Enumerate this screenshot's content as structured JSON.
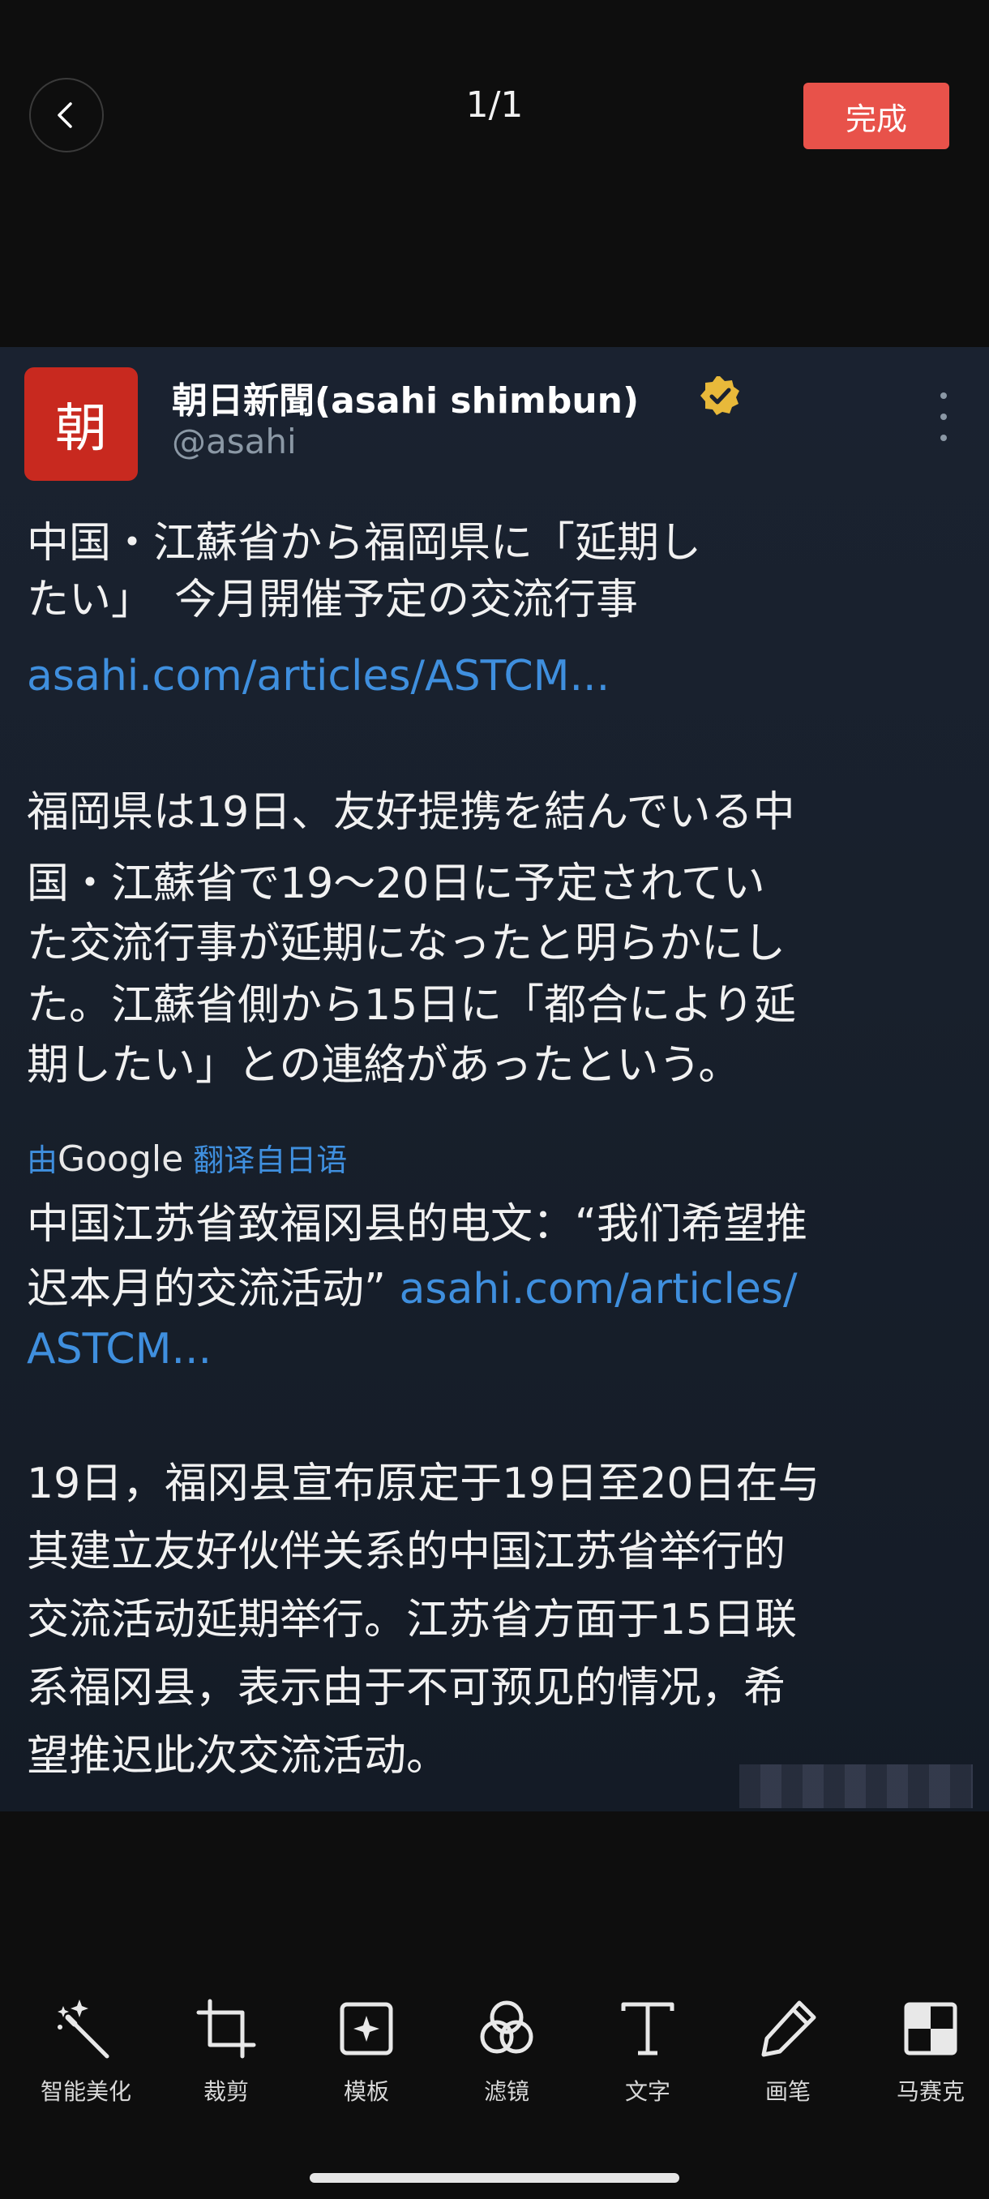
{
  "top_bar": {
    "page_counter": "1/1",
    "done_label": "完成"
  },
  "post": {
    "avatar_text": "朝",
    "account_name": "朝日新聞(asahi shimbun)",
    "handle": "@asahi",
    "headline_lines": [
      "中国・江蘇省から福岡県に「延期し",
      "たい」　今月開催予定の交流行事"
    ],
    "headline_link": "asahi.com/articles/ASTCM...",
    "body_ja_lines": [
      "福岡県は19日、友好提携を結んでいる中",
      "国・江蘇省で19～20日に予定されてい",
      "た交流行事が延期になったと明らかにし",
      "た。江蘇省側から15日に「都合により延",
      "期したい」との連絡があったという。"
    ],
    "translate_prefix": "由",
    "translate_brand": "Google",
    "translate_suffix": " 翻译自日语",
    "translated_headline_line1": "中国江苏省致福冈县的电文：“我们希望推",
    "translated_headline_line2": "迟本月的交流活动”",
    "translated_link_part1": "asahi.com/articles/",
    "translated_link_part2": "ASTCM...",
    "body_zh_lines": [
      "19日，福冈县宣布原定于19日至20日在与",
      "其建立友好伙伴关系的中国江苏省举行的",
      "交流活动延期举行。江苏省方面于15日联",
      "系福冈县，表示由于不可预见的情况，希",
      "望推迟此次交流活动。"
    ]
  },
  "toolbar": {
    "items": [
      {
        "label": "智能美化",
        "icon": "magic-wand-icon"
      },
      {
        "label": "裁剪",
        "icon": "crop-icon"
      },
      {
        "label": "模板",
        "icon": "template-icon"
      },
      {
        "label": "滤镜",
        "icon": "filter-icon"
      },
      {
        "label": "文字",
        "icon": "text-icon"
      },
      {
        "label": "画笔",
        "icon": "pen-icon"
      },
      {
        "label": "马赛克",
        "icon": "mosaic-icon"
      }
    ]
  },
  "colors": {
    "background": "#0e0e0e",
    "done_button": "#e8524a",
    "link": "#3f8fde",
    "avatar": "#c8291f",
    "verified_badge": "#e8b93a"
  }
}
